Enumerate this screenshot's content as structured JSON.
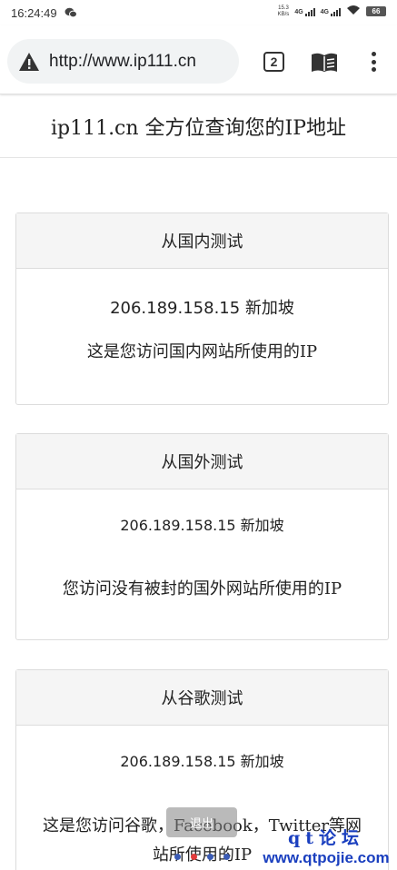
{
  "status_bar": {
    "time": "16:24:49",
    "speed_value": "15.3",
    "speed_unit": "KB/s",
    "network_1": "4G",
    "network_2": "4G",
    "battery": "66",
    "icons": [
      "wechat-icon",
      "signal-icon",
      "wifi-icon",
      "battery-icon"
    ]
  },
  "browser": {
    "url": "http://www.ip111.cn",
    "tab_count": "2",
    "icons": [
      "warning-icon",
      "reader-mode-icon",
      "menu-icon"
    ]
  },
  "page": {
    "title": "ip111.cn 全方位查询您的IP地址",
    "cards": [
      {
        "header": "从国内测试",
        "ip": "206.189.158.15 新加坡",
        "description": "这是您访问国内网站所使用的IP"
      },
      {
        "header": "从国外测试",
        "ip": "206.189.158.15 新加坡",
        "description": "您访问没有被封的国外网站所使用的IP"
      },
      {
        "header": "从谷歌测试",
        "ip": "206.189.158.15 新加坡",
        "description": "这是您访问谷歌，Facebook，Twitter等网站所使用的IP"
      }
    ]
  },
  "overlay": {
    "exit_label": "退出",
    "watermark_top": "qt论坛",
    "watermark_bottom": "www.qtpojie.com"
  },
  "colors": {
    "watermark": "#1a3fbf",
    "card_header_bg": "#f5f5f5",
    "omnibox_bg": "#f1f3f4"
  }
}
